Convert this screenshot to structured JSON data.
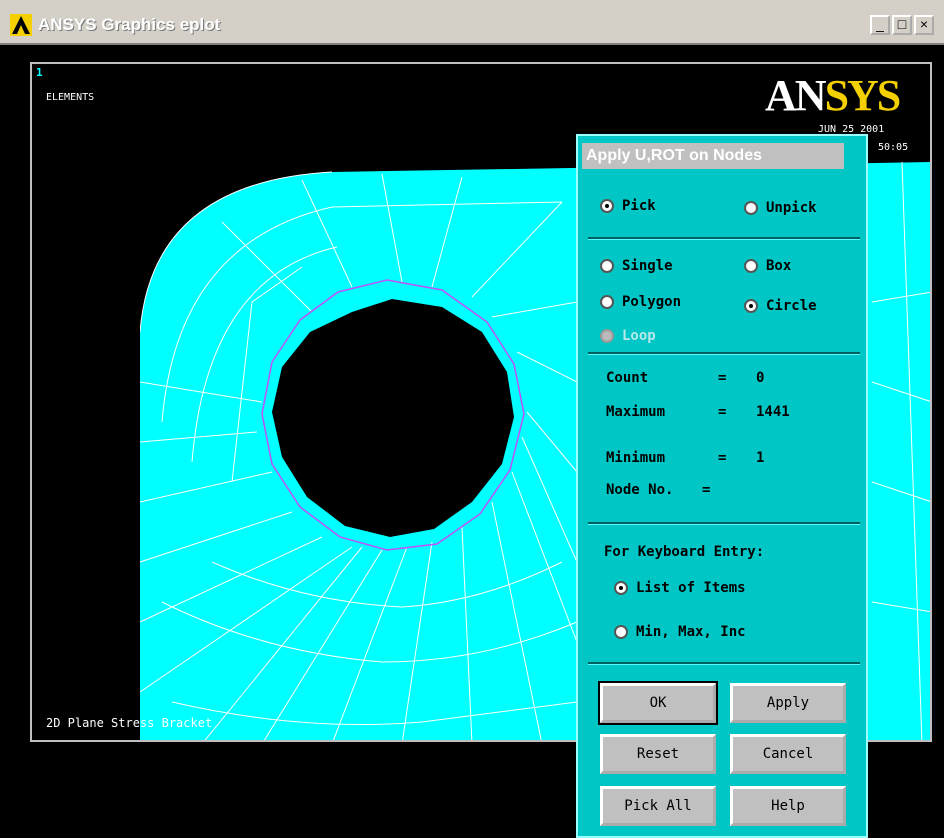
{
  "window": {
    "title": "ANSYS Graphics  eplot",
    "buttons": {
      "minimize": "_",
      "maximize": "□",
      "close": "×"
    }
  },
  "graphics": {
    "window_number": "1",
    "plot_type": "ELEMENTS",
    "brand_part1": "AN",
    "brand_part2": "SYS",
    "date": "JUN 25 2001",
    "time": "50:05",
    "model_title": "2D Plane Stress Bracket",
    "colors": {
      "mesh_fill": "#00ffff",
      "mesh_lines": "#ffffff",
      "selection_ring": "#c050ff"
    }
  },
  "dialog": {
    "title": "Apply U,ROT on Nodes",
    "mode": {
      "pick": "Pick",
      "unpick": "Unpick",
      "selected": "Pick"
    },
    "pick_type": {
      "single": "Single",
      "box": "Box",
      "polygon": "Polygon",
      "circle": "Circle",
      "loop": "Loop",
      "selected": "Circle"
    },
    "stats": {
      "count_label": "Count",
      "count_value": "0",
      "maximum_label": "Maximum",
      "maximum_value": "1441",
      "minimum_label": "Minimum",
      "minimum_value": "1",
      "node_label": "Node No."
    },
    "keyboard": {
      "heading": "For Keyboard Entry:",
      "list_items": "List of Items",
      "min_max_inc": "Min, Max, Inc",
      "selected": "List of Items"
    },
    "buttons": {
      "ok": "OK",
      "apply": "Apply",
      "reset": "Reset",
      "cancel": "Cancel",
      "pick_all": "Pick All",
      "help": "Help"
    }
  }
}
